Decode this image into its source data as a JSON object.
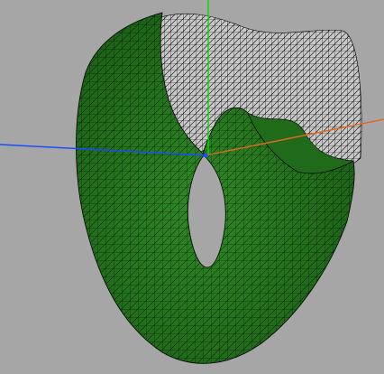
{
  "viewport": {
    "background_color": "#a6a6a6"
  },
  "mesh": {
    "fill_color": "#1f6b1a",
    "highlight_color": "#2f8a25",
    "wire_color": "#000000",
    "inner_surface_color": "#c8c8c8"
  },
  "axes": {
    "x_color": "#e0681e",
    "y_color": "#00dd00",
    "z_color": "#1a4cff"
  }
}
